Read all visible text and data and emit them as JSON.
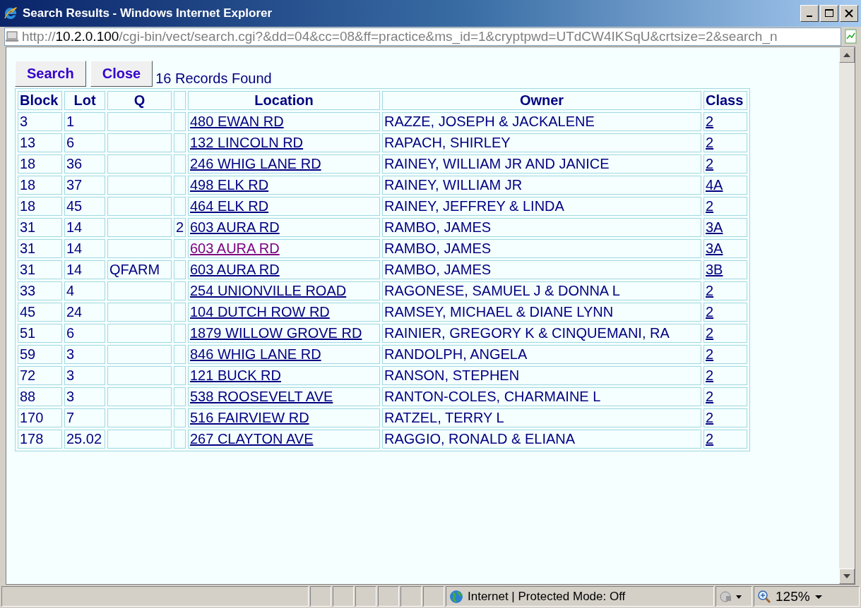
{
  "window": {
    "title": "Search Results - Windows Internet Explorer"
  },
  "address": {
    "scheme": "http://",
    "host": "10.2.0.100",
    "path": "/cgi-bin/vect/search.cgi?&dd=04&cc=08&ff=practice&ms_id=1&cryptpwd=UTdCW4IKSqU&crtsize=2&search_n"
  },
  "buttons": [
    "Search",
    "Close"
  ],
  "records_found": "16 Records Found",
  "table": {
    "columns": [
      "Block",
      "Lot",
      "Q",
      "",
      "Location",
      "Owner",
      "Class"
    ],
    "rows": [
      {
        "block": "3",
        "lot": "1",
        "q": "",
        "column_4": "",
        "location": "480 EWAN RD",
        "visited": false,
        "owner": "RAZZE, JOSEPH & JACKALENE",
        "class": "2"
      },
      {
        "block": "13",
        "lot": "6",
        "q": "",
        "column_4": "",
        "location": "132 LINCOLN RD",
        "visited": false,
        "owner": "RAPACH, SHIRLEY",
        "class": "2"
      },
      {
        "block": "18",
        "lot": "36",
        "q": "",
        "column_4": "",
        "location": "246 WHIG LANE RD",
        "visited": false,
        "owner": "RAINEY, WILLIAM JR AND JANICE",
        "class": "2"
      },
      {
        "block": "18",
        "lot": "37",
        "q": "",
        "column_4": "",
        "location": "498 ELK RD",
        "visited": false,
        "owner": "RAINEY, WILLIAM JR",
        "class": "4A"
      },
      {
        "block": "18",
        "lot": "45",
        "q": "",
        "column_4": "",
        "location": "464 ELK RD",
        "visited": false,
        "owner": "RAINEY, JEFFREY & LINDA",
        "class": "2"
      },
      {
        "block": "31",
        "lot": "14",
        "q": "",
        "column_4": "2",
        "location": "603 AURA RD",
        "visited": false,
        "owner": "RAMBO, JAMES",
        "class": "3A"
      },
      {
        "block": "31",
        "lot": "14",
        "q": "",
        "column_4": "",
        "location": "603 AURA RD",
        "visited": true,
        "owner": "RAMBO, JAMES",
        "class": "3A"
      },
      {
        "block": "31",
        "lot": "14",
        "q": "QFARM",
        "column_4": "",
        "location": "603 AURA RD",
        "visited": false,
        "owner": "RAMBO, JAMES",
        "class": "3B"
      },
      {
        "block": "33",
        "lot": "4",
        "q": "",
        "column_4": "",
        "location": "254 UNIONVILLE ROAD",
        "visited": false,
        "owner": "RAGONESE, SAMUEL J & DONNA L",
        "class": "2"
      },
      {
        "block": "45",
        "lot": "24",
        "q": "",
        "column_4": "",
        "location": "104 DUTCH ROW RD",
        "visited": false,
        "owner": "RAMSEY, MICHAEL & DIANE LYNN",
        "class": "2"
      },
      {
        "block": "51",
        "lot": "6",
        "q": "",
        "column_4": "",
        "location": "1879 WILLOW GROVE RD",
        "visited": false,
        "owner": "RAINIER, GREGORY K & CINQUEMANI, RA",
        "class": "2"
      },
      {
        "block": "59",
        "lot": "3",
        "q": "",
        "column_4": "",
        "location": "846 WHIG LANE RD",
        "visited": false,
        "owner": "RANDOLPH, ANGELA",
        "class": "2"
      },
      {
        "block": "72",
        "lot": "3",
        "q": "",
        "column_4": "",
        "location": "121 BUCK RD",
        "visited": false,
        "owner": "RANSON, STEPHEN",
        "class": "2"
      },
      {
        "block": "88",
        "lot": "3",
        "q": "",
        "column_4": "",
        "location": "538 ROOSEVELT AVE",
        "visited": false,
        "owner": "RANTON-COLES, CHARMAINE L",
        "class": "2"
      },
      {
        "block": "170",
        "lot": "7",
        "q": "",
        "column_4": "",
        "location": "516 FAIRVIEW RD",
        "visited": false,
        "owner": "RATZEL, TERRY L",
        "class": "2"
      },
      {
        "block": "178",
        "lot": "25.02",
        "q": "",
        "column_4": "",
        "location": "267 CLAYTON AVE",
        "visited": false,
        "owner": "RAGGIO, RONALD & ELIANA",
        "class": "2"
      }
    ]
  },
  "status_bar": {
    "zone": "Internet | Protected Mode: Off",
    "zoom": "125%"
  }
}
